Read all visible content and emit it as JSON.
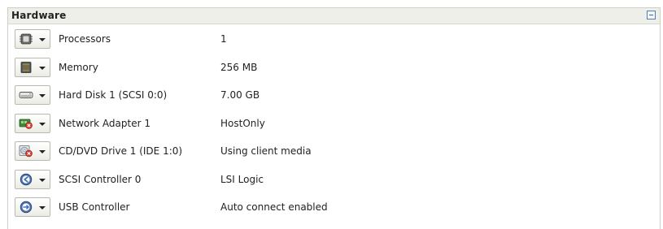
{
  "panel": {
    "title": "Hardware",
    "collapse_icon": "minus-box-icon",
    "accent_color": "#4f7fb7"
  },
  "devices": [
    {
      "name": "Processors",
      "value": "1",
      "icon": "processor-chip-icon"
    },
    {
      "name": "Memory",
      "value": "256 MB",
      "icon": "memory-module-icon"
    },
    {
      "name": "Hard Disk 1 (SCSI 0:0)",
      "value": "7.00 GB",
      "icon": "hard-disk-icon"
    },
    {
      "name": "Network Adapter 1",
      "value": "HostOnly",
      "icon": "network-adapter-disconnected-icon"
    },
    {
      "name": "CD/DVD Drive 1 (IDE 1:0)",
      "value": "Using client media",
      "icon": "cd-dvd-drive-disconnected-icon"
    },
    {
      "name": "SCSI Controller 0",
      "value": "LSI Logic",
      "icon": "scsi-controller-icon"
    },
    {
      "name": "USB Controller",
      "value": "Auto connect enabled",
      "icon": "usb-controller-icon"
    }
  ]
}
